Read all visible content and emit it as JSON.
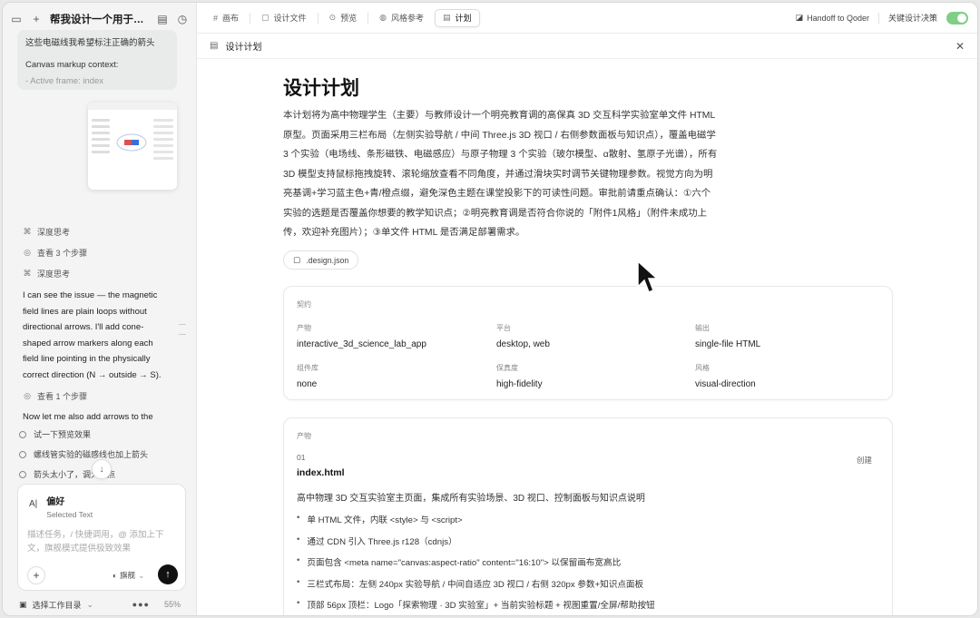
{
  "sidebar": {
    "title": "帮我设计一个用于高中...",
    "bubble_line1": "这些电磁线我希望标注正确的箭头",
    "bubble_line2": "Canvas markup context:",
    "bubble_line3": "- Active frame: index",
    "steps": [
      {
        "icon": "brain-icon",
        "label": "深度思考"
      },
      {
        "icon": "eye-icon",
        "label": "查看 3 个步骤"
      },
      {
        "icon": "brain-icon",
        "label": "深度思考"
      }
    ],
    "assistant_text": "I can see the issue — the magnetic field lines are plain loops without directional arrows. I'll add cone-shaped arrow markers along each field line pointing in the physically correct direction (N → outside → S).",
    "step_view1": "查看 1 个步骤",
    "assistant_text2": "Now let me also add arrows to the",
    "suggestions": [
      "试一下预览效果",
      "螺线管实验的磁感线也加上箭头",
      "箭头太小了，调大一点"
    ],
    "composer": {
      "pref_title": "偏好",
      "pref_sub": "Selected Text",
      "placeholder": "描述任务，/ 快捷调用，@ 添加上下文，旗舰模式提供极致效果",
      "mode": "旗舰"
    },
    "footer": {
      "workdir": "选择工作目录",
      "percent": "55%"
    }
  },
  "topbar": {
    "tabs": [
      {
        "icon": "grid-icon",
        "label": "画布",
        "active": false
      },
      {
        "icon": "file-icon",
        "label": "设计文件",
        "active": false
      },
      {
        "icon": "preview-icon",
        "label": "预览",
        "active": false
      },
      {
        "icon": "palette-icon",
        "label": "风格参考",
        "active": false
      },
      {
        "icon": "clipboard-icon",
        "label": "计划",
        "active": true
      }
    ],
    "handoff": "Handoff to Qoder",
    "toggle_label": "关键设计决策",
    "toggle_on": true
  },
  "docbar": {
    "title": "设计计划"
  },
  "doc": {
    "title": "设计计划",
    "intro": "本计划将为高中物理学生（主要）与教师设计一个明亮教育调的高保真 3D 交互科学实验室单文件 HTML 原型。页面采用三栏布局（左侧实验导航 / 中间 Three.js 3D 视口 / 右侧参数面板与知识点），覆盖电磁学 3 个实验（电场线、条形磁铁、电磁感应）与原子物理 3 个实验（玻尔模型、α散射、氢原子光谱），所有 3D 模型支持鼠标拖拽旋转、滚轮缩放查看不同角度，并通过滑块实时调节关键物理参数。视觉方向为明亮基调+学习蓝主色+青/橙点缀，避免深色主题在课堂投影下的可读性问题。审批前请重点确认：①六个实验的选题是否覆盖你想要的教学知识点；②明亮教育调是否符合你说的「附件1风格」（附件未成功上传，欢迎补充图片）；③单文件 HTML 是否满足部署需求。",
    "chip": ".design.json",
    "contract": {
      "label": "契约",
      "fields": [
        {
          "k": "产物",
          "v": "interactive_3d_science_lab_app"
        },
        {
          "k": "平台",
          "v": "desktop, web"
        },
        {
          "k": "输出",
          "v": "single-file HTML"
        },
        {
          "k": "组件库",
          "v": "none"
        },
        {
          "k": "保真度",
          "v": "high-fidelity"
        },
        {
          "k": "风格",
          "v": "visual-direction"
        }
      ]
    },
    "artifacts": {
      "label": "产物",
      "num": "01",
      "name": "index.html",
      "action": "创建",
      "desc": "高中物理 3D 交互实验室主页面，集成所有实验场景、3D 视口、控制面板与知识点说明",
      "bullets": [
        "单 HTML 文件，内联 <style> 与 <script>",
        "通过 CDN 引入 Three.js r128（cdnjs）",
        "页面包含 <meta name=\"canvas:aspect-ratio\" content=\"16:10\"> 以保留画布宽高比",
        "三栏式布局：左侧 240px 实验导航 / 中间自适应 3D 视口 / 右侧 320px 参数+知识点面板",
        "顶部 56px 顶栏：Logo「探索物理 · 3D 实验室」+ 当前实验标题 + 视图重置/全屏/帮助按钮"
      ]
    }
  },
  "colors": {
    "accent_toggle": "#7fcf85",
    "send_button": "#111111"
  }
}
